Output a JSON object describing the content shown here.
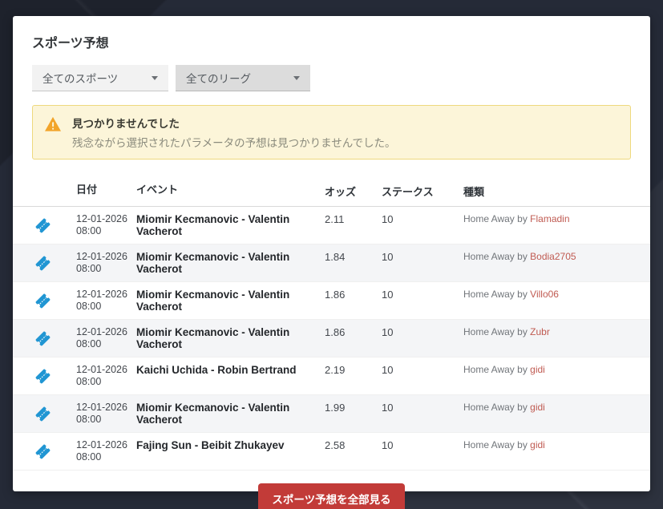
{
  "page": {
    "title": "スポーツ予想"
  },
  "filters": {
    "sport": {
      "value": "全てのスポーツ"
    },
    "league": {
      "value": "全てのリーグ"
    }
  },
  "alert": {
    "title": "見つかりませんでした",
    "message": "残念ながら選択されたパラメータの予想は見つかりませんでした。"
  },
  "table": {
    "headers": {
      "date": "日付",
      "event": "イベント",
      "odds": "オッズ",
      "stakes": "ステークス",
      "type": "種類"
    },
    "rows": [
      {
        "date": "12-01-2026",
        "time": "08:00",
        "event": "Miomir Kecmanovic - Valentin Vacherot",
        "odds": "2.11",
        "stakes": "10",
        "type_prefix": "Home Away by ",
        "type_user": "Flamadin"
      },
      {
        "date": "12-01-2026",
        "time": "08:00",
        "event": "Miomir Kecmanovic - Valentin Vacherot",
        "odds": "1.84",
        "stakes": "10",
        "type_prefix": "Home Away by ",
        "type_user": "Bodia2705"
      },
      {
        "date": "12-01-2026",
        "time": "08:00",
        "event": "Miomir Kecmanovic - Valentin Vacherot",
        "odds": "1.86",
        "stakes": "10",
        "type_prefix": "Home Away by ",
        "type_user": "Villo06"
      },
      {
        "date": "12-01-2026",
        "time": "08:00",
        "event": "Miomir Kecmanovic - Valentin Vacherot",
        "odds": "1.86",
        "stakes": "10",
        "type_prefix": "Home Away by ",
        "type_user": "Zubr"
      },
      {
        "date": "12-01-2026",
        "time": "08:00",
        "event": "Kaichi Uchida - Robin Bertrand",
        "odds": "2.19",
        "stakes": "10",
        "type_prefix": "Home Away by ",
        "type_user": "gidi"
      },
      {
        "date": "12-01-2026",
        "time": "08:00",
        "event": "Miomir Kecmanovic - Valentin Vacherot",
        "odds": "1.99",
        "stakes": "10",
        "type_prefix": "Home Away by ",
        "type_user": "gidi"
      },
      {
        "date": "12-01-2026",
        "time": "08:00",
        "event": "Fajing Sun - Beibit Zhukayev",
        "odds": "2.58",
        "stakes": "10",
        "type_prefix": "Home Away by ",
        "type_user": "gidi"
      }
    ]
  },
  "footer": {
    "view_all_label": "スポーツ予想を全部見る"
  },
  "icons": {
    "ticket": "ticket-icon",
    "warning": "warning-triangle-icon",
    "chevron": "chevron-down-icon"
  },
  "colors": {
    "accent_button": "#c23b38",
    "username_link": "#c05b52",
    "ticket_blue": "#2196d3",
    "warning_amber": "#f2a42a",
    "alert_bg": "#fcf5d9",
    "alert_border": "#eed97e",
    "page_bg": "#252a37",
    "row_stripe": "#f4f5f7"
  }
}
